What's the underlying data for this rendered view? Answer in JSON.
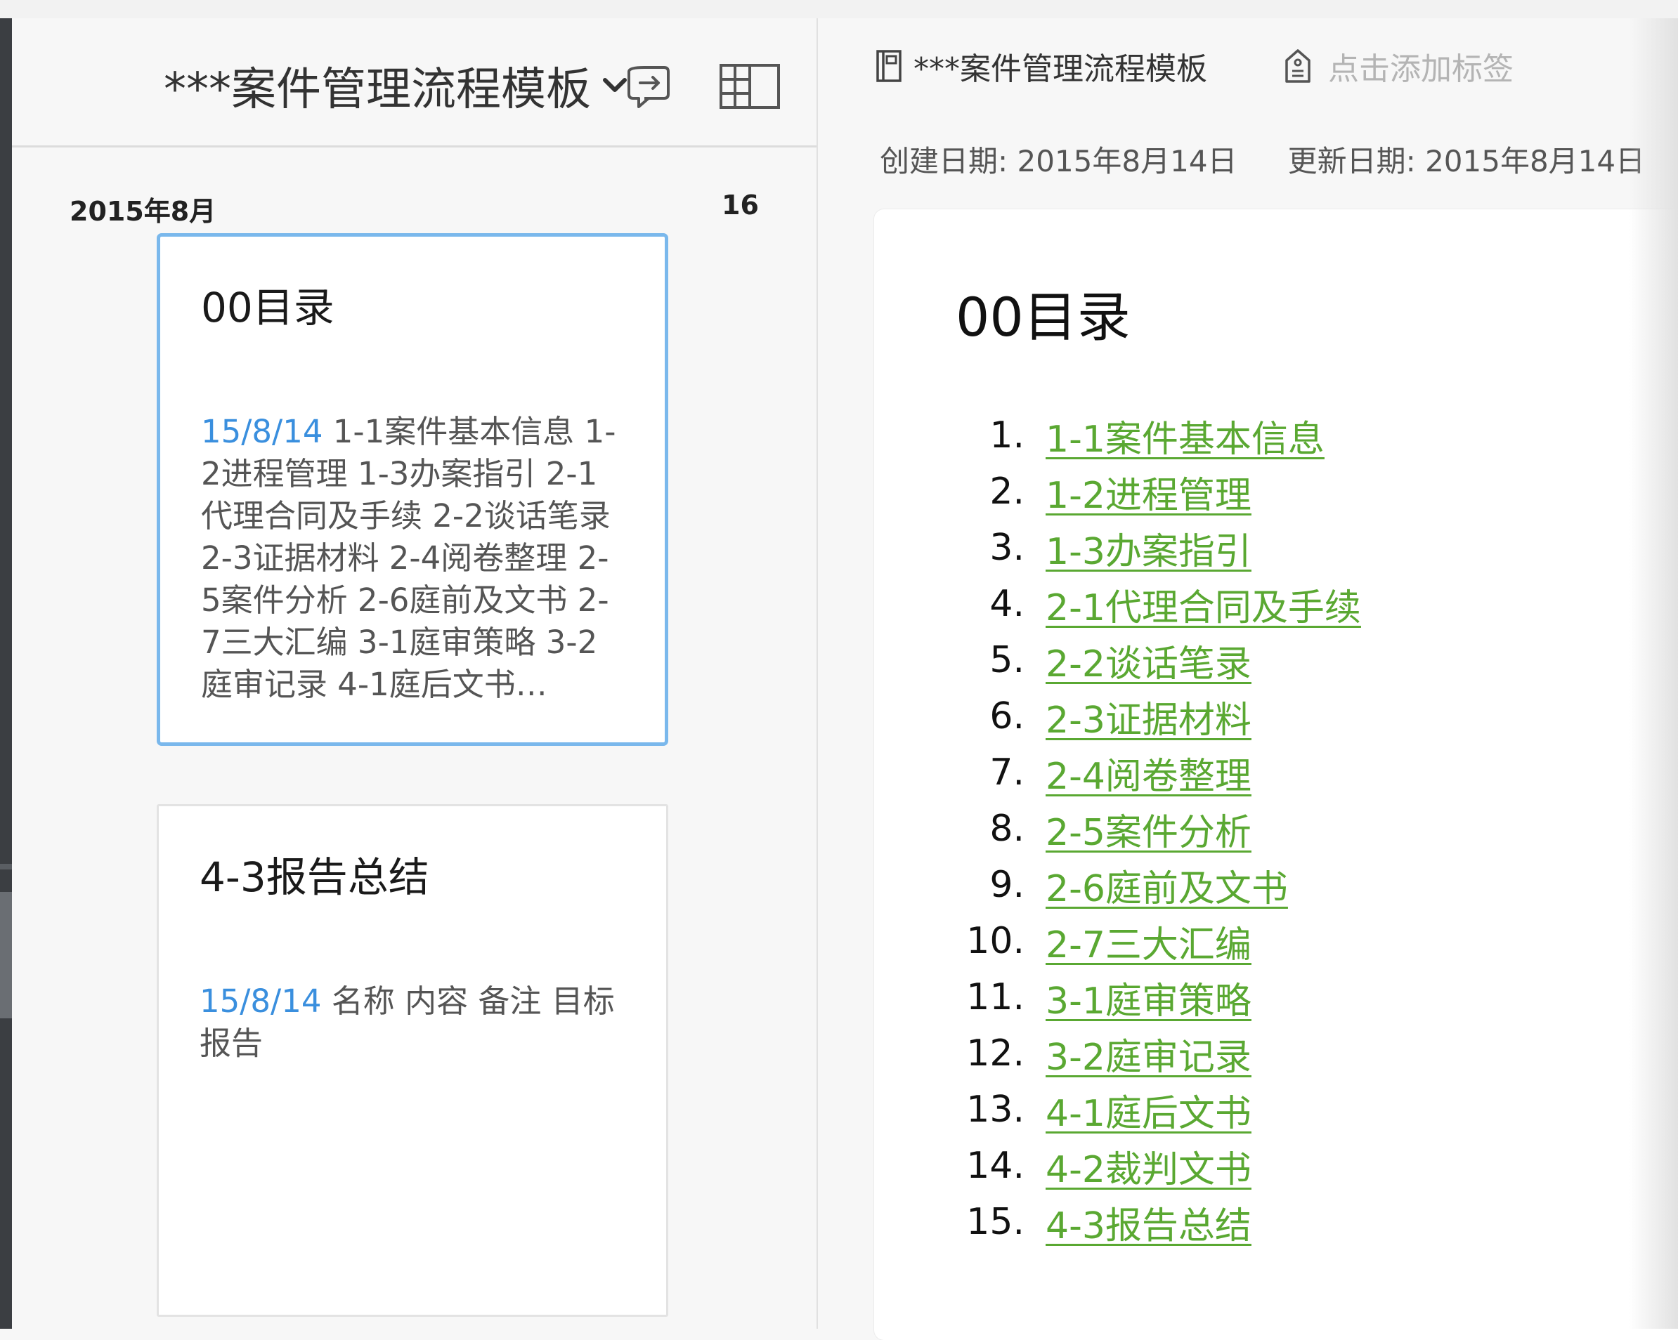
{
  "list_header": {
    "notebook_title": "***案件管理流程模板"
  },
  "note_list": {
    "group_label": "2015年8月",
    "group_count": "16",
    "notes": [
      {
        "title": "00目录",
        "date": "15/8/14",
        "snippet": "1-1案件基本信息 1-2进程管理 1-3办案指引 2-1代理合同及手续 2-2谈话笔录 2-3证据材料 2-4阅卷整理 2-5案件分析 2-6庭前及文书 2-7三大汇编 3-1庭审策略 3-2庭审记录 4-1庭后文书…"
      },
      {
        "title": "4-3报告总结",
        "date": "15/8/14",
        "snippet": "名称 内容 备注 目标报告"
      }
    ]
  },
  "editor": {
    "notebook_name": "***案件管理流程模板",
    "tags_placeholder": "点击添加标签",
    "created": "创建日期: 2015年8月14日",
    "updated": "更新日期: 2015年8月14日",
    "title": "00目录",
    "toc": [
      {
        "num": "1.",
        "label": "1-1案件基本信息"
      },
      {
        "num": "2.",
        "label": "1-2进程管理"
      },
      {
        "num": "3.",
        "label": "1-3办案指引"
      },
      {
        "num": "4.",
        "label": "2-1代理合同及手续"
      },
      {
        "num": "5.",
        "label": "2-2谈话笔录"
      },
      {
        "num": "6.",
        "label": "2-3证据材料"
      },
      {
        "num": "7.",
        "label": "2-4阅卷整理"
      },
      {
        "num": "8.",
        "label": "2-5案件分析"
      },
      {
        "num": "9.",
        "label": "2-6庭前及文书"
      },
      {
        "num": "10.",
        "label": "2-7三大汇编"
      },
      {
        "num": "11.",
        "label": "3-1庭审策略"
      },
      {
        "num": "12.",
        "label": "3-2庭审记录"
      },
      {
        "num": "13.",
        "label": "4-1庭后文书"
      },
      {
        "num": "14.",
        "label": "4-2裁判文书"
      },
      {
        "num": "15.",
        "label": "4-3报告总结"
      }
    ]
  },
  "colors": {
    "link_green": "#5aa832",
    "date_blue": "#3a8fde",
    "selected_border": "#7ab8ec"
  },
  "icons": {
    "notebook_dropdown": "chevron-down-icon",
    "share": "share-icon",
    "view_toggle": "layout-toggle-icon",
    "notebook": "notebook-icon",
    "tag": "tag-icon"
  }
}
